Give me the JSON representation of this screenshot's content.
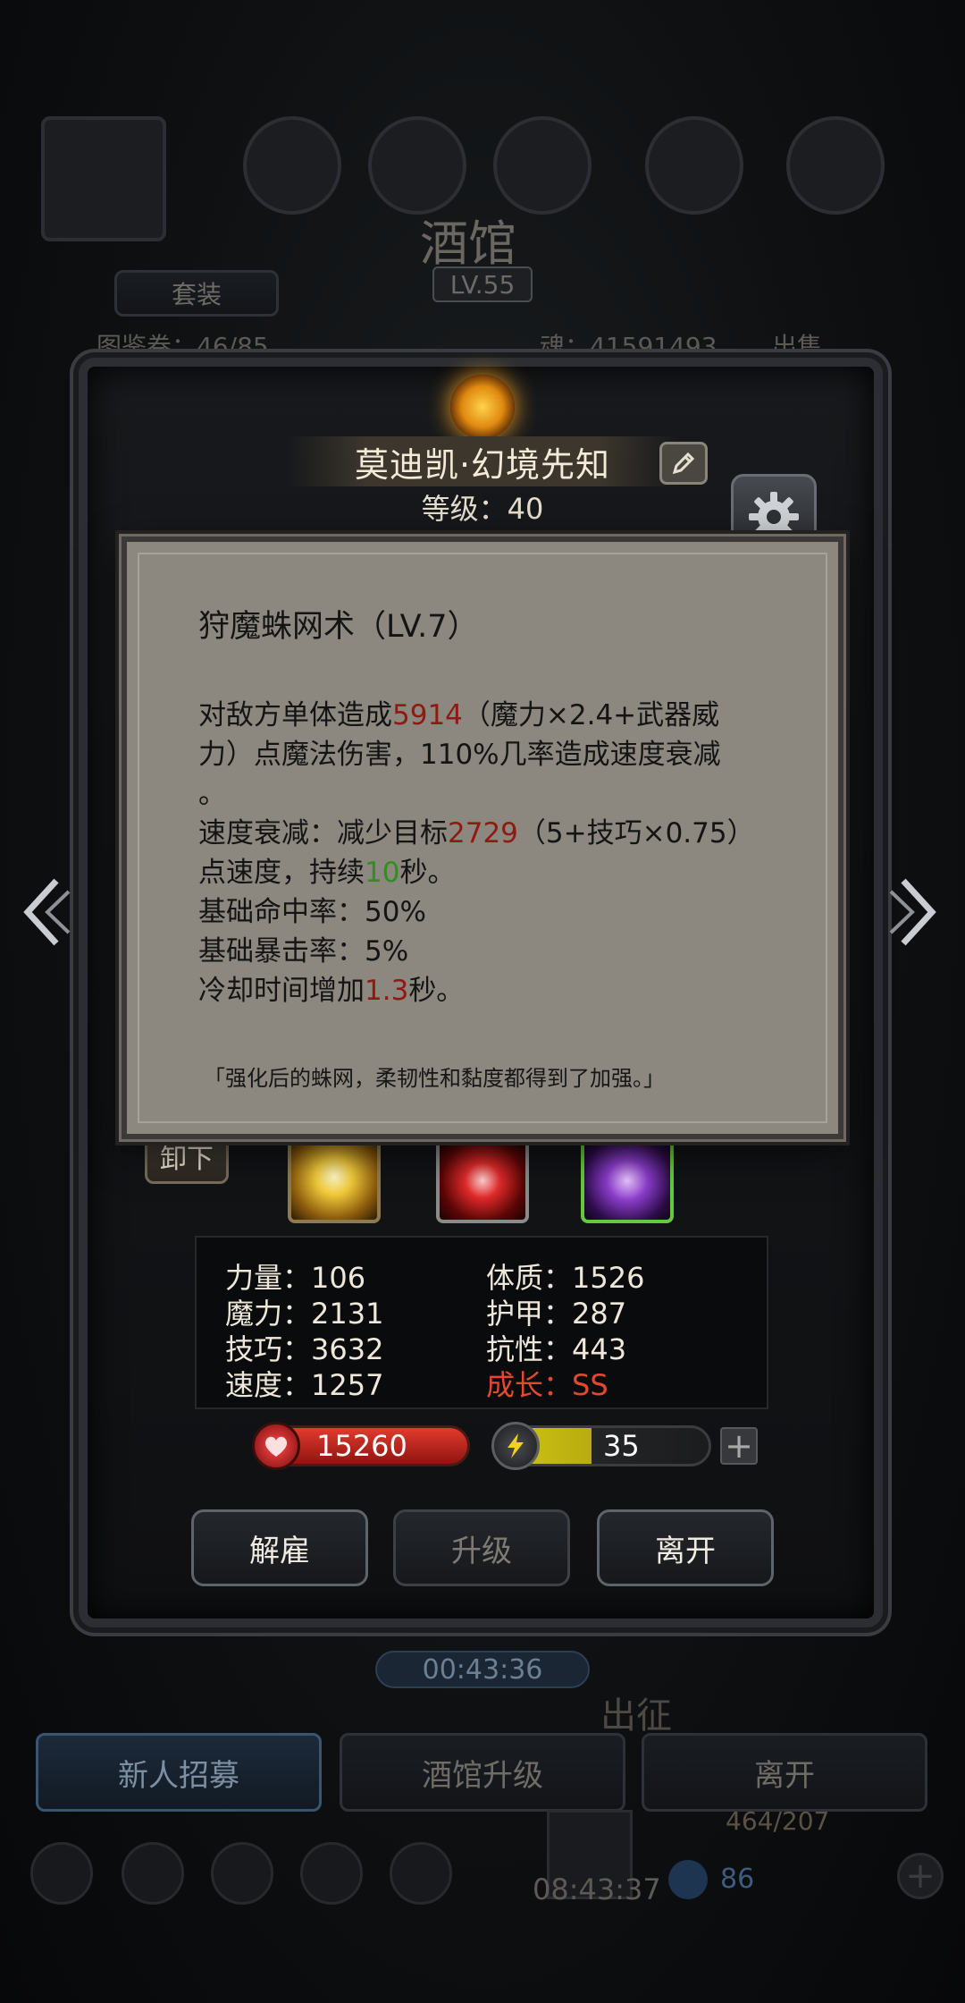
{
  "background": {
    "title": "酒馆",
    "level": "LV.55",
    "tab_label": "套装",
    "left_counter": "图鉴卷：46/85",
    "right_counter": "魂：41591493",
    "right_tag": "出售",
    "timer": "00:43:36",
    "section_label": "出征",
    "buttons": [
      "新人招募",
      "酒馆升级",
      "离开"
    ],
    "bottom_counter": "464/207",
    "bottom_timer": "08:43:37",
    "bottom_value": "86"
  },
  "hero": {
    "name": "莫迪凯·幻境先知",
    "level_text": "等级：40",
    "unequip_label": "卸下",
    "stats": {
      "strength": "力量：106",
      "magic": "魔力：2131",
      "skill": "技巧：3632",
      "speed": "速度：1257",
      "constitution": "体质：1526",
      "armor": "护甲：287",
      "resistance": "抗性：443",
      "growth": "成长：SS"
    },
    "hp": "15260",
    "energy": "35",
    "energy_fill_fraction": 0.45,
    "buttons": {
      "dismiss": "解雇",
      "upgrade": "升级",
      "leave": "离开"
    }
  },
  "tooltip": {
    "title": "狩魔蛛网术（LV.7）",
    "line1_a": "对敌方单体造成",
    "damage": "5914",
    "line1_b": "（魔力×2.4+武器威",
    "line2": "力）点魔法伤害，110%几率造成速度衰减",
    "line3": "。",
    "line4_a": "速度衰减：减少目标",
    "slow_value": "2729",
    "line4_b": "（5+技巧×0.75）",
    "line5_a": "点速度，持续",
    "duration": "10",
    "line5_b": "秒。",
    "line6": "基础命中率：50%",
    "line7": "基础暴击率：5%",
    "line8_a": "冷却时间增加",
    "cooldown": "1.3",
    "line8_b": "秒。",
    "flavor": "「强化后的蛛网，柔韧性和黏度都得到了加强。」"
  },
  "colors": {
    "tooltip_bg": "#8c877f",
    "highlight_red": "#8e1a12",
    "highlight_green": "#2f8f1f",
    "growth_red": "#e2492f",
    "hp_red": "#e23a2d",
    "energy_yellow": "#d1c516"
  },
  "icons": [
    "edit-icon",
    "gear-icon",
    "chevron-left-icon",
    "chevron-right-icon",
    "heart-icon",
    "lightning-icon",
    "plus-icon"
  ]
}
